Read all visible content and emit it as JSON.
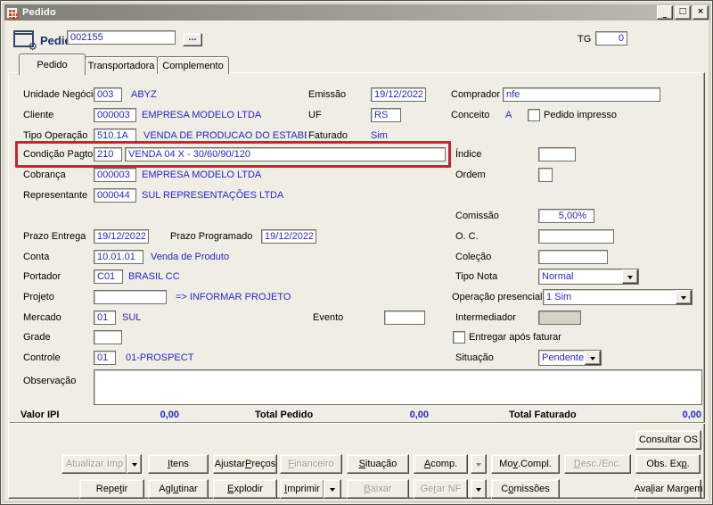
{
  "window": {
    "title": "Pedido"
  },
  "icons": {
    "minimize": "_",
    "maximize": "□",
    "close": "×",
    "ellipsis": "...",
    "gear": "⚙"
  },
  "colors": {
    "highlight_red": "#C92430",
    "value_blue": "#2727CC"
  },
  "header": {
    "form_label": "Pedido",
    "order_number": "002155",
    "tg_label": "TG",
    "tg_value": "0"
  },
  "tabs": {
    "pedido": "Pedido",
    "transportadora": "Transportadora",
    "complemento": "Complemento"
  },
  "fields": {
    "unidade_negocio": {
      "label": "Unidade Negócio",
      "code": "003",
      "desc": "ABYZ"
    },
    "emissao": {
      "label": "Emissão",
      "value": "19/12/2022"
    },
    "comprador": {
      "label": "Comprador",
      "value": "nfe"
    },
    "cliente": {
      "label": "Cliente",
      "code": "000003",
      "desc": "EMPRESA MODELO LTDA"
    },
    "uf": {
      "label": "UF",
      "value": "RS"
    },
    "conceito": {
      "label": "Conceito",
      "value": "A"
    },
    "pedido_impresso": {
      "label": "Pedido impresso",
      "checked": false
    },
    "tipo_operacao": {
      "label": "Tipo Operação",
      "code": "510.1A",
      "desc": "VENDA DE PRODUCAO DO ESTABELECIMEI"
    },
    "faturado": {
      "label": "Faturado",
      "value": "Sim"
    },
    "condicao_pagto": {
      "label": "Condição Pagto.",
      "code": "210",
      "desc": "VENDA 04 X - 30/60/90/120"
    },
    "indice": {
      "label": "Índice",
      "value": ""
    },
    "cobranca": {
      "label": "Cobrança",
      "code": "000003",
      "desc": "EMPRESA MODELO LTDA"
    },
    "ordem": {
      "label": "Ordem",
      "value": ""
    },
    "representante": {
      "label": "Representante",
      "code": "000044",
      "desc": "SUL REPRESENTAÇÕES LTDA"
    },
    "comissao": {
      "label": "Comissão",
      "value": "5,00%"
    },
    "prazo_entrega": {
      "label": "Prazo Entrega",
      "value": "19/12/2022"
    },
    "prazo_programado": {
      "label": "Prazo Programado",
      "value": "19/12/2022"
    },
    "oc": {
      "label": "O. C.",
      "value": ""
    },
    "conta": {
      "label": "Conta",
      "code": "10.01.01",
      "desc": "Venda de Produto"
    },
    "colecao": {
      "label": "Coleção",
      "value": ""
    },
    "portador": {
      "label": "Portador",
      "code": "C01",
      "desc": "BRASIL CC"
    },
    "tipo_nota": {
      "label": "Tipo Nota",
      "value": "Normal"
    },
    "projeto": {
      "label": "Projeto",
      "value": "",
      "hint": "=> INFORMAR PROJETO"
    },
    "operacao_presencial": {
      "label": "Operação presencial",
      "value": "1 Sim"
    },
    "mercado": {
      "label": "Mercado",
      "code": "01",
      "desc": "SUL"
    },
    "evento": {
      "label": "Evento",
      "value": ""
    },
    "intermediador": {
      "label": "Intermediador",
      "value": ""
    },
    "grade": {
      "label": "Grade",
      "value": ""
    },
    "entregar_apos_faturar": {
      "label": "Entregar após faturar",
      "checked": false
    },
    "controle": {
      "label": "Controle",
      "code": "01",
      "desc": "01-PROSPECT"
    },
    "situacao": {
      "label": "Situação",
      "value": "Pendente"
    },
    "observacao": {
      "label": "Observação",
      "value": ""
    }
  },
  "totals": {
    "valor_ipi": {
      "label": "Valor IPI",
      "value": "0,00"
    },
    "total_pedido": {
      "label": "Total Pedido",
      "value": "0,00"
    },
    "total_faturado": {
      "label": "Total Faturado",
      "value": "0,00"
    }
  },
  "buttons": {
    "consultar_os": {
      "label": "Consultar OS",
      "enabled": true
    },
    "row1": [
      {
        "label": "Atualizar Imp",
        "u": null,
        "enabled": false,
        "arrow": true
      },
      {
        "label": "Itens",
        "u": 0,
        "enabled": true
      },
      {
        "label": "Ajustar Preços",
        "u": 8,
        "enabled": true
      },
      {
        "label": "Financeiro",
        "u": 0,
        "enabled": false
      },
      {
        "label": "Situação",
        "u": 0,
        "enabled": true
      },
      {
        "label": "Acomp.",
        "u": 0,
        "enabled": true,
        "arrow": true
      },
      {
        "label": "Mov.Compl.",
        "u": 2,
        "enabled": true
      },
      {
        "label": "Desc./Enc.",
        "u": 0,
        "enabled": false
      },
      {
        "label": "Obs. Exp.",
        "u": 7,
        "enabled": true
      }
    ],
    "row2": [
      {
        "label": "Repetir",
        "u": 4,
        "enabled": true
      },
      {
        "label": "Aglutinar",
        "u": 3,
        "enabled": true
      },
      {
        "label": "Explodir",
        "u": 0,
        "enabled": true
      },
      {
        "label": "Imprimir",
        "u": 0,
        "enabled": true,
        "arrow": true
      },
      {
        "label": "Baixar",
        "u": 0,
        "enabled": false
      },
      {
        "label": "Gerar NF",
        "u": 2,
        "enabled": false,
        "arrow": true
      },
      {
        "label": "Comissões",
        "u": 1,
        "enabled": true
      },
      {
        "label": "Avaliar Margem",
        "u": 3,
        "enabled": true
      }
    ]
  }
}
